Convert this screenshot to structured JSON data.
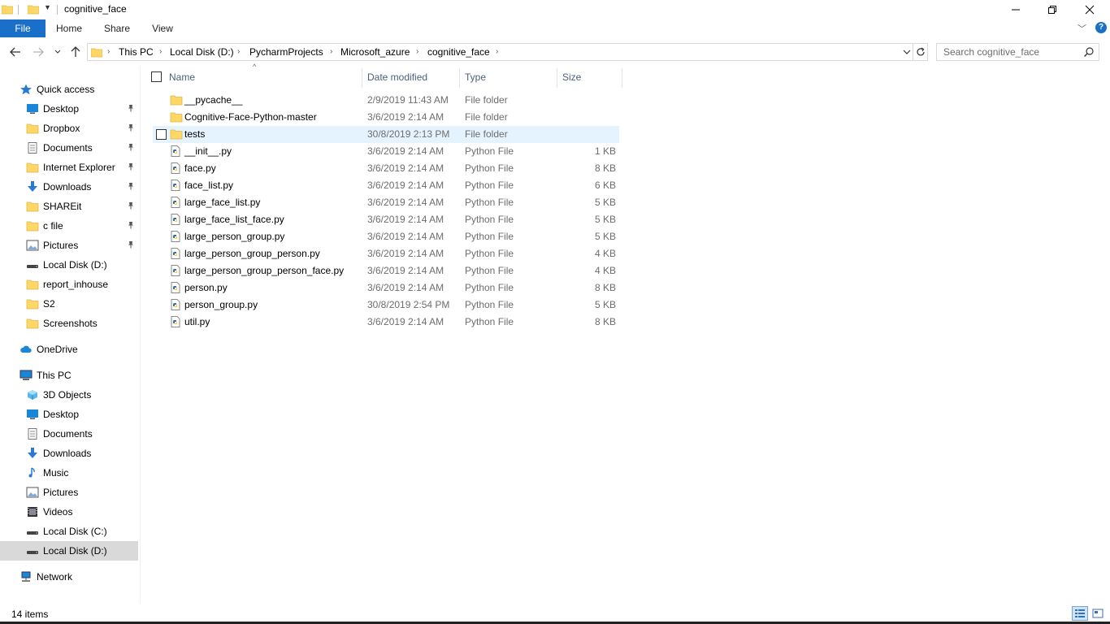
{
  "window": {
    "title": "cognitive_face",
    "minimize_glyph": "─",
    "close_glyph": "✕"
  },
  "ribbon": {
    "tabs": [
      "File",
      "Home",
      "Share",
      "View"
    ],
    "help_label": "?"
  },
  "address_bar": {
    "breadcrumbs": [
      "This PC",
      "Local Disk (D:)",
      "PycharmProjects",
      "Microsoft_azure",
      "cognitive_face"
    ]
  },
  "search": {
    "placeholder": "Search cognitive_face"
  },
  "sidebar": {
    "items": [
      {
        "label": "Quick access",
        "icon": "star-icon",
        "pinned": false
      },
      {
        "label": "Desktop",
        "icon": "desktop-icon",
        "pinned": true
      },
      {
        "label": "Dropbox",
        "icon": "folder-icon",
        "pinned": true
      },
      {
        "label": "Documents",
        "icon": "documents-icon",
        "pinned": true
      },
      {
        "label": "Internet Explorer",
        "icon": "folder-icon",
        "pinned": true
      },
      {
        "label": "Downloads",
        "icon": "download-icon",
        "pinned": true
      },
      {
        "label": "SHAREit",
        "icon": "folder-icon",
        "pinned": true
      },
      {
        "label": "c file",
        "icon": "folder-icon",
        "pinned": true
      },
      {
        "label": "Pictures",
        "icon": "pictures-icon",
        "pinned": true
      },
      {
        "label": "Local Disk (D:)",
        "icon": "drive-icon",
        "pinned": false
      },
      {
        "label": "report_inhouse",
        "icon": "folder-icon",
        "pinned": false
      },
      {
        "label": "S2",
        "icon": "folder-icon",
        "pinned": false
      },
      {
        "label": "Screenshots",
        "icon": "folder-icon",
        "pinned": false
      },
      {
        "label": "OneDrive",
        "icon": "cloud-icon",
        "pinned": false
      },
      {
        "label": "This PC",
        "icon": "computer-icon",
        "pinned": false
      },
      {
        "label": "3D Objects",
        "icon": "cube-icon",
        "pinned": false
      },
      {
        "label": "Desktop",
        "icon": "desktop-icon",
        "pinned": false
      },
      {
        "label": "Documents",
        "icon": "documents-icon",
        "pinned": false
      },
      {
        "label": "Downloads",
        "icon": "download-icon",
        "pinned": false
      },
      {
        "label": "Music",
        "icon": "music-icon",
        "pinned": false
      },
      {
        "label": "Pictures",
        "icon": "pictures-icon",
        "pinned": false
      },
      {
        "label": "Videos",
        "icon": "video-icon",
        "pinned": false
      },
      {
        "label": "Local Disk (C:)",
        "icon": "drive-icon",
        "pinned": false
      },
      {
        "label": "Local Disk (D:)",
        "icon": "drive-icon",
        "pinned": false,
        "selected": true
      },
      {
        "label": "Network",
        "icon": "network-icon",
        "pinned": false
      }
    ]
  },
  "file_list": {
    "columns": [
      "Name",
      "Date modified",
      "Type",
      "Size"
    ],
    "rows": [
      {
        "name": "__pycache__",
        "date": "2/9/2019 11:43 AM",
        "type": "File folder",
        "size": "",
        "kind": "folder"
      },
      {
        "name": "Cognitive-Face-Python-master",
        "date": "3/6/2019 2:14 AM",
        "type": "File folder",
        "size": "",
        "kind": "folder"
      },
      {
        "name": "tests",
        "date": "30/8/2019 2:13 PM",
        "type": "File folder",
        "size": "",
        "kind": "folder",
        "hover": true
      },
      {
        "name": "__init__.py",
        "date": "3/6/2019 2:14 AM",
        "type": "Python File",
        "size": "1 KB",
        "kind": "python"
      },
      {
        "name": "face.py",
        "date": "3/6/2019 2:14 AM",
        "type": "Python File",
        "size": "8 KB",
        "kind": "python"
      },
      {
        "name": "face_list.py",
        "date": "3/6/2019 2:14 AM",
        "type": "Python File",
        "size": "6 KB",
        "kind": "python"
      },
      {
        "name": "large_face_list.py",
        "date": "3/6/2019 2:14 AM",
        "type": "Python File",
        "size": "5 KB",
        "kind": "python"
      },
      {
        "name": "large_face_list_face.py",
        "date": "3/6/2019 2:14 AM",
        "type": "Python File",
        "size": "5 KB",
        "kind": "python"
      },
      {
        "name": "large_person_group.py",
        "date": "3/6/2019 2:14 AM",
        "type": "Python File",
        "size": "5 KB",
        "kind": "python"
      },
      {
        "name": "large_person_group_person.py",
        "date": "3/6/2019 2:14 AM",
        "type": "Python File",
        "size": "4 KB",
        "kind": "python"
      },
      {
        "name": "large_person_group_person_face.py",
        "date": "3/6/2019 2:14 AM",
        "type": "Python File",
        "size": "4 KB",
        "kind": "python"
      },
      {
        "name": "person.py",
        "date": "3/6/2019 2:14 AM",
        "type": "Python File",
        "size": "8 KB",
        "kind": "python"
      },
      {
        "name": "person_group.py",
        "date": "30/8/2019 2:54 PM",
        "type": "Python File",
        "size": "5 KB",
        "kind": "python"
      },
      {
        "name": "util.py",
        "date": "3/6/2019 2:14 AM",
        "type": "Python File",
        "size": "8 KB",
        "kind": "python"
      }
    ]
  },
  "status_bar": {
    "item_count": "14 items"
  },
  "colors": {
    "accent": "#1a6fc8",
    "folder": "#ffd766",
    "hover_row": "#e5f3ff",
    "selected_nav": "#d9d9d9"
  }
}
